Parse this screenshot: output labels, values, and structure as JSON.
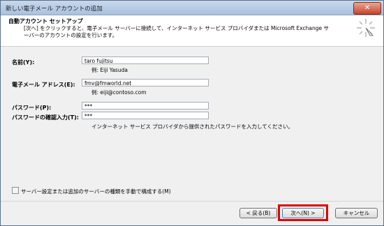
{
  "window": {
    "title": "新しい電子メール アカウントの追加",
    "close_glyph": "✕"
  },
  "header": {
    "title": "自動アカウント セットアップ",
    "description": "[次へ] をクリックすると、電子メール サーバーに接続して、インターネット サービス プロバイダまたは Microsoft Exchange サーバーのアカウントの設定を行います。"
  },
  "form": {
    "name": {
      "label": "名前(Y):",
      "value": "taro fujitsu",
      "example": "例: Eiji Yasuda"
    },
    "email": {
      "label": "電子メール アドレス(E):",
      "value": "fmv@fmworld.net",
      "example": "例: eiji@contoso.com"
    },
    "password": {
      "label": "パスワード(P):",
      "value": "***"
    },
    "password_confirm": {
      "label": "パスワードの確認入力(T):",
      "value": "***"
    },
    "password_hint": "インターネット サービス プロバイダから提供されたパスワードを入力してください。",
    "manual_config": {
      "label": "サーバー設定または追加のサーバーの種類を手動で構成する(M)",
      "checked": false
    }
  },
  "buttons": {
    "back": "< 戻る(B)",
    "next": "次へ(N) >",
    "cancel": "キャンセル"
  },
  "colors": {
    "highlight": "#e00000"
  }
}
